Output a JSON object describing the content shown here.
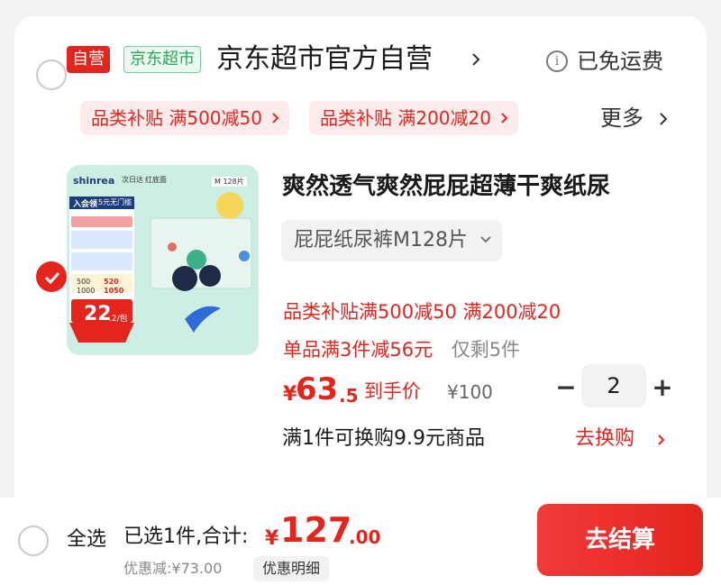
{
  "store": {
    "self_tag": "自营",
    "supermarket_tag": "京东超市",
    "name": "京东超市官方自营",
    "free_shipping": "已免运费",
    "info_icon": "info-icon",
    "promos": [
      "品类补贴 满500减50",
      "品类补贴 满200减20"
    ],
    "more_label": "更多"
  },
  "product": {
    "title": "爽然透气爽然屁屁超薄干爽纸尿",
    "spec": "屁屁纸尿裤M128片",
    "promo_line1": "品类补贴满500减50   满200减20",
    "promo_line2": "单品满3件减56元",
    "remaining": "仅剩5件",
    "price_symbol": "¥",
    "price_int": "63",
    "price_dec": ".5",
    "price_label": "到手价",
    "original_price": "¥100",
    "quantity": "2",
    "minus_label": "−",
    "plus_label": "+",
    "exchange_text": "满1件可换购9.9元商品",
    "exchange_link": "去换购",
    "image_texts": {
      "brand": "shinrea",
      "size_tag": "M 128片",
      "tag1": "次日达",
      "tag2": "红底面",
      "member": "入会领",
      "coupon": "5元无门槛",
      "big_price": "22",
      "unit": ".2/包",
      "offer1": "500",
      "offer2": "520",
      "offer3": "1000",
      "offer4": "1050"
    }
  },
  "footer": {
    "select_all": "全选",
    "selected_info": "已选1件,合计:",
    "total_symbol": "¥",
    "total_int": "127",
    "total_dec": ".00",
    "discount": "优惠减:¥73.00",
    "discount_detail": "优惠明细",
    "checkout": "去结算"
  },
  "colors": {
    "accent": "#e4251e",
    "supermarket_green": "#26a85b",
    "chip_bg": "#fdeceb"
  }
}
